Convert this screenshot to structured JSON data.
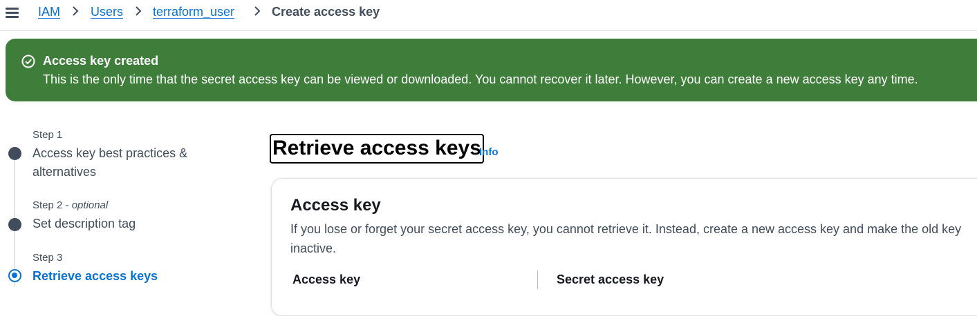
{
  "breadcrumb": {
    "items": [
      "IAM",
      "Users",
      "terraform_user"
    ],
    "current": "Create access key"
  },
  "flash": {
    "title": "Access key created",
    "message": "This is the only time that the secret access key can be viewed or downloaded. You cannot recover it later. However, you can create a new access key any time.",
    "color": "#3f7e3a"
  },
  "steps": [
    {
      "number": "Step 1",
      "optional": "",
      "label": "Access key best practices & alternatives"
    },
    {
      "number": "Step 2",
      "optional": "optional",
      "label": "Set description tag"
    },
    {
      "number": "Step 3",
      "optional": "",
      "label": "Retrieve access keys"
    }
  ],
  "main": {
    "title": "Retrieve access keys",
    "info_link": "Info",
    "container": {
      "title": "Access key",
      "description": "If you lose or forget your secret access key, you cannot retrieve it. Instead, create a new access key and make the old key inactive.",
      "columns": [
        "Access key",
        "Secret access key"
      ]
    }
  },
  "colors": {
    "link": "#0972d3",
    "text": "#16191f",
    "secondary_text": "#414d5c"
  }
}
